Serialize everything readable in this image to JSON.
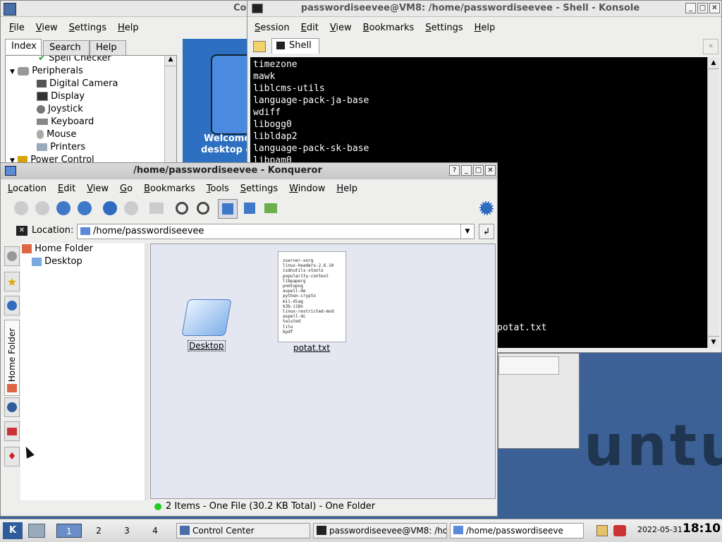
{
  "control_center": {
    "title": "Control Center",
    "title_visible": "Co",
    "menu": [
      "File",
      "View",
      "Settings",
      "Help"
    ],
    "tabs": [
      "Index",
      "Search",
      "Help"
    ],
    "tree": [
      {
        "label": "Spell Checker",
        "indent": 2
      },
      {
        "label": "Peripherals",
        "indent": 1
      },
      {
        "label": "Digital Camera",
        "indent": 2
      },
      {
        "label": "Display",
        "indent": 2
      },
      {
        "label": "Joystick",
        "indent": 2
      },
      {
        "label": "Keyboard",
        "indent": 2
      },
      {
        "label": "Mouse",
        "indent": 2
      },
      {
        "label": "Printers",
        "indent": 2
      },
      {
        "label": "Power Control",
        "indent": 1
      }
    ],
    "welcome_text_1": "Welcome",
    "welcome_text_2": "desktop c"
  },
  "konsole": {
    "title": "passwordiseevee@VM8: /home/passwordiseevee - Shell - Konsole",
    "menu": [
      "Session",
      "Edit",
      "View",
      "Bookmarks",
      "Settings",
      "Help"
    ],
    "tab_label": "Shell",
    "lines": [
      "timezone",
      "mawk",
      "liblcms-utils",
      "language-pack-ja-base",
      "wdiff",
      "libogg0",
      "libldap2",
      "language-pack-sk-base",
      "libpam0"
    ],
    "last_line": "potat.txt"
  },
  "konqueror": {
    "title": "/home/passwordiseevee - Konqueror",
    "menu": [
      "Location",
      "Edit",
      "View",
      "Go",
      "Bookmarks",
      "Tools",
      "Settings",
      "Window",
      "Help"
    ],
    "location_label": "Location:",
    "location_value": "/home/passwordiseevee",
    "tree": [
      "Home Folder",
      "Desktop"
    ],
    "sidebar_tab_label": "Home Folder",
    "files": [
      {
        "name": "Desktop",
        "type": "folder"
      },
      {
        "name": "potat.txt",
        "type": "text"
      }
    ],
    "preview_lines": [
      "xserver-xorg",
      "linux-headers-2.6.10",
      "isdnutils-xtools",
      "popularity-contest",
      "libpaperg",
      "pnmtopng",
      "aspell-de",
      "python-crypto",
      "mii-diag",
      "k3b-i18n",
      "linux-restricted-mod",
      "aspell-dc",
      "twisted",
      "lilo",
      "kpdf"
    ],
    "status": "2 Items - One File (30.2 KB Total) - One Folder"
  },
  "desktop": {
    "brand_text": "untu"
  },
  "taskbar": {
    "desktops": [
      "1",
      "2",
      "3",
      "4"
    ],
    "tasks": [
      {
        "label": "Control Center"
      },
      {
        "label": "passwordiseevee@VM8: /hor"
      },
      {
        "label": "/home/passwordiseeve"
      }
    ],
    "date": "2022-05-31",
    "time": "18:10"
  },
  "colors": {
    "desktop_bg": "#3a5f94",
    "terminal_bg": "#000000",
    "terminal_fg": "#ffffff",
    "icon_view_bg": "#e4e6f2"
  }
}
